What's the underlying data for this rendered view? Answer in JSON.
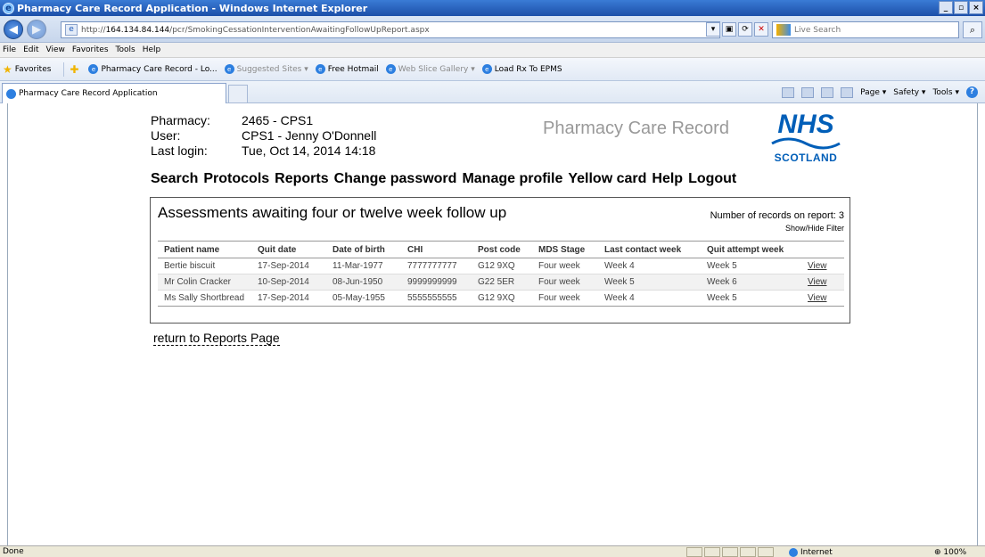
{
  "window": {
    "title": "Pharmacy Care Record Application - Windows Internet Explorer",
    "buttons": [
      "_",
      "▫",
      "×"
    ]
  },
  "browser": {
    "url_prefix": "http://",
    "url_host": "164.134.84.144",
    "url_path": "/pcr/SmokingCessationInterventionAwaitingFollowUpReport.aspx",
    "search_placeholder": "Live Search",
    "menu": [
      "File",
      "Edit",
      "View",
      "Favorites",
      "Tools",
      "Help"
    ],
    "favorites_label": "Favorites",
    "favorites": [
      {
        "label": "Pharmacy Care Record - Lo...",
        "dim": false
      },
      {
        "label": "Suggested Sites ▾",
        "dim": true
      },
      {
        "label": "Free Hotmail",
        "dim": false
      },
      {
        "label": "Web Slice Gallery ▾",
        "dim": true
      },
      {
        "label": "Load Rx To EPMS",
        "dim": false
      }
    ],
    "tab_label": "Pharmacy Care Record Application",
    "commands": [
      "Page ▾",
      "Safety ▾",
      "Tools ▾"
    ]
  },
  "header": {
    "pharmacy_label": "Pharmacy:",
    "pharmacy_value": "2465 - CPS1",
    "user_label": "User:",
    "user_value": "CPS1 - Jenny O'Donnell",
    "login_label": "Last login:",
    "login_value": "Tue, Oct 14, 2014 14:18",
    "brand": "Pharmacy Care Record",
    "logo_nhs": "NHS",
    "logo_region": "SCOTLAND"
  },
  "nav": [
    "Search",
    "Protocols",
    "Reports",
    "Change password",
    "Manage profile",
    "Yellow card",
    "Help",
    "Logout"
  ],
  "report": {
    "title": "Assessments awaiting four or twelve week follow up",
    "records_label": "Number of records on report:  3",
    "filter_link": "Show/Hide Filter",
    "columns": [
      "Patient name",
      "Quit date",
      "Date of birth",
      "CHI",
      "Post code",
      "MDS Stage",
      "Last contact week",
      "Quit attempt week",
      ""
    ],
    "rows": [
      [
        "Bertie biscuit",
        "17-Sep-2014",
        "11-Mar-1977",
        "7777777777",
        "G12 9XQ",
        "Four week",
        "Week 4",
        "Week 5",
        "View"
      ],
      [
        "Mr Colin Cracker",
        "10-Sep-2014",
        "08-Jun-1950",
        "9999999999",
        "G22 5ER",
        "Four week",
        "Week 5",
        "Week 6",
        "View"
      ],
      [
        "Ms Sally Shortbread",
        "17-Sep-2014",
        "05-May-1955",
        "5555555555",
        "G12 9XQ",
        "Four week",
        "Week 4",
        "Week 5",
        "View"
      ]
    ],
    "return_link": "return to Reports Page"
  },
  "status": {
    "text": "Done",
    "zone": "Internet",
    "zoom": "100%"
  }
}
